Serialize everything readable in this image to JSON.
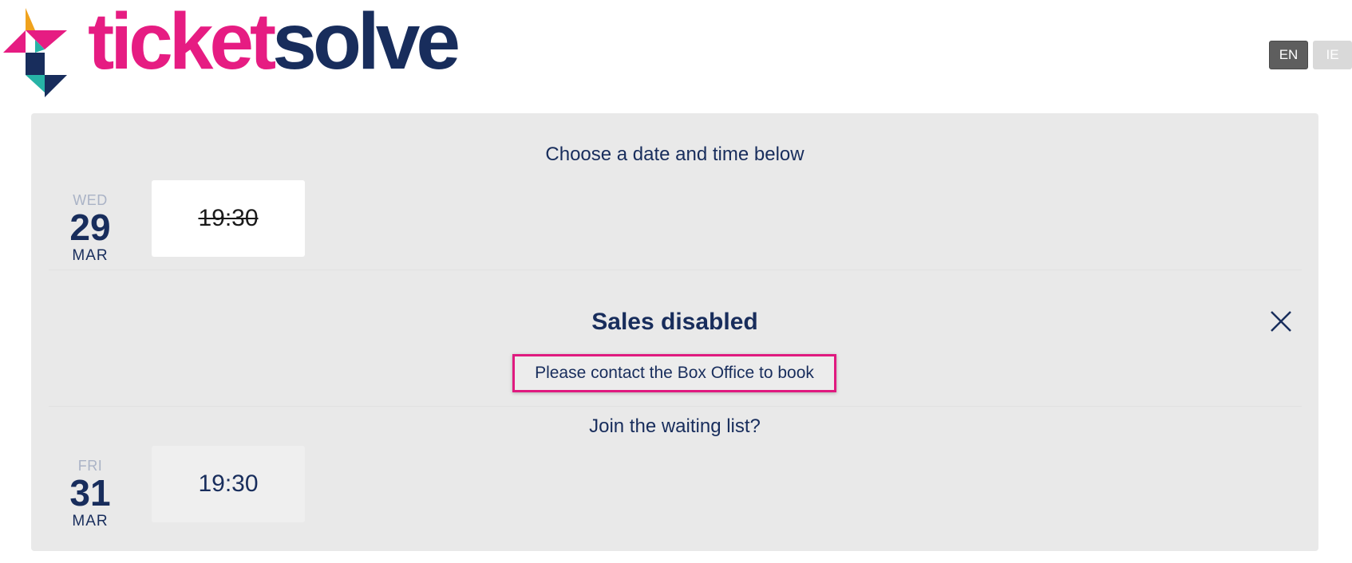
{
  "header": {
    "logo": {
      "word_part_1": "ticket",
      "word_part_2": "solve",
      "colors": {
        "pink": "#e61c82",
        "navy": "#182d5c",
        "orange": "#f0a21d",
        "teal": "#27b3a6"
      }
    },
    "languages": [
      {
        "code": "EN",
        "active": true
      },
      {
        "code": "IE",
        "active": false
      }
    ]
  },
  "main": {
    "heading": "Choose a date and time below",
    "performances": [
      {
        "dow": "WED",
        "day": "29",
        "month": "MAR",
        "times": [
          {
            "label": "19:30",
            "state": "selected-disabled"
          }
        ]
      },
      {
        "dow": "FRI",
        "day": "31",
        "month": "MAR",
        "times": [
          {
            "label": "19:30",
            "state": "available"
          }
        ]
      }
    ],
    "sales_notice": {
      "title": "Sales disabled",
      "message": "Please contact the Box Office to book",
      "close_icon": "close-x-icon"
    },
    "waiting_list_link": "Join the waiting list?"
  },
  "colors": {
    "panel_bg": "#e9e9e9",
    "text_navy": "#182d5c",
    "highlight_border": "#e01a7f",
    "lang_active_bg": "#5e5e5e",
    "lang_inactive_bg": "#d9d9d9"
  }
}
